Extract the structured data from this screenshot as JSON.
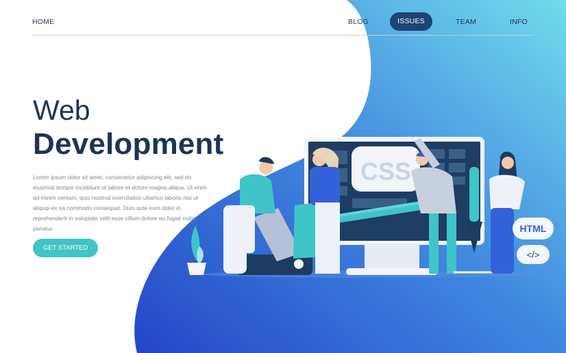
{
  "nav": {
    "home": "HOME",
    "blog": "BLOG",
    "issues": "ISSUES",
    "team": "TEAM",
    "info": "INFO"
  },
  "hero": {
    "title_line1": "Web",
    "title_line2": "Development",
    "body": "Lorem ipsum dolor sit amet, consectetur adipiscing elit, sed do eiusmod tempor incididunt ut labore et dolore magna aliqua. Ut enim ad minim veniam, quis nostrud exercitation ullamco laboris nisi ut aliquip ex ea commodo consequat. Duis aute irure dolor in reprehenderit in voluptate velit esse cillum dolore eu fugiat nulla pariatur.",
    "cta": "GET STARTED"
  },
  "illustration": {
    "screen_label": "CSS",
    "badge_html": "HTML",
    "badge_code": "</>"
  },
  "colors": {
    "accent_teal": "#3fc4c8",
    "nav_active": "#1b4474",
    "headline": "#1b3556",
    "blob_dark": "#2b4fcf",
    "blob_light": "#69d3ea"
  }
}
